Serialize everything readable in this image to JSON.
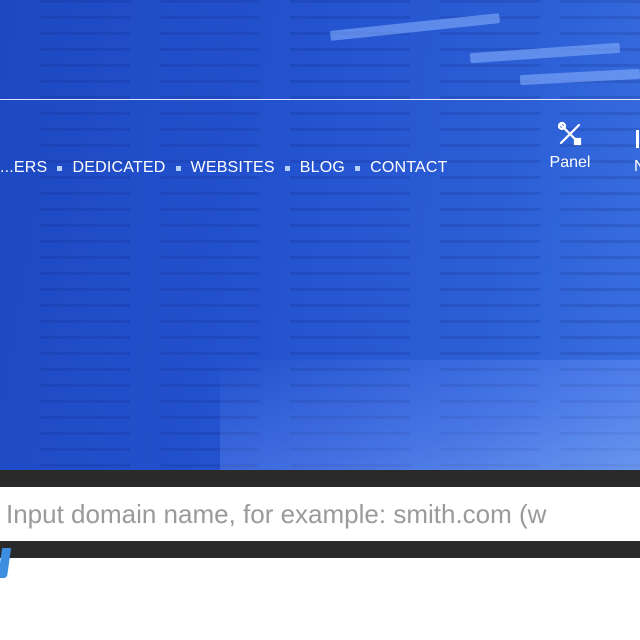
{
  "nav": {
    "items": [
      "...ERS",
      "DEDICATED",
      "WEBSITES",
      "BLOG",
      "CONTACT"
    ]
  },
  "panel": {
    "label": "Panel",
    "icon": "tools-icon"
  },
  "cut_item": {
    "label": "N"
  },
  "search": {
    "placeholder": "Input domain name, for example: smith.com (w"
  },
  "colors": {
    "hero_blue": "#2453cf",
    "band_dark": "#2a2a2a",
    "accent_blue": "#3d8ee0"
  }
}
